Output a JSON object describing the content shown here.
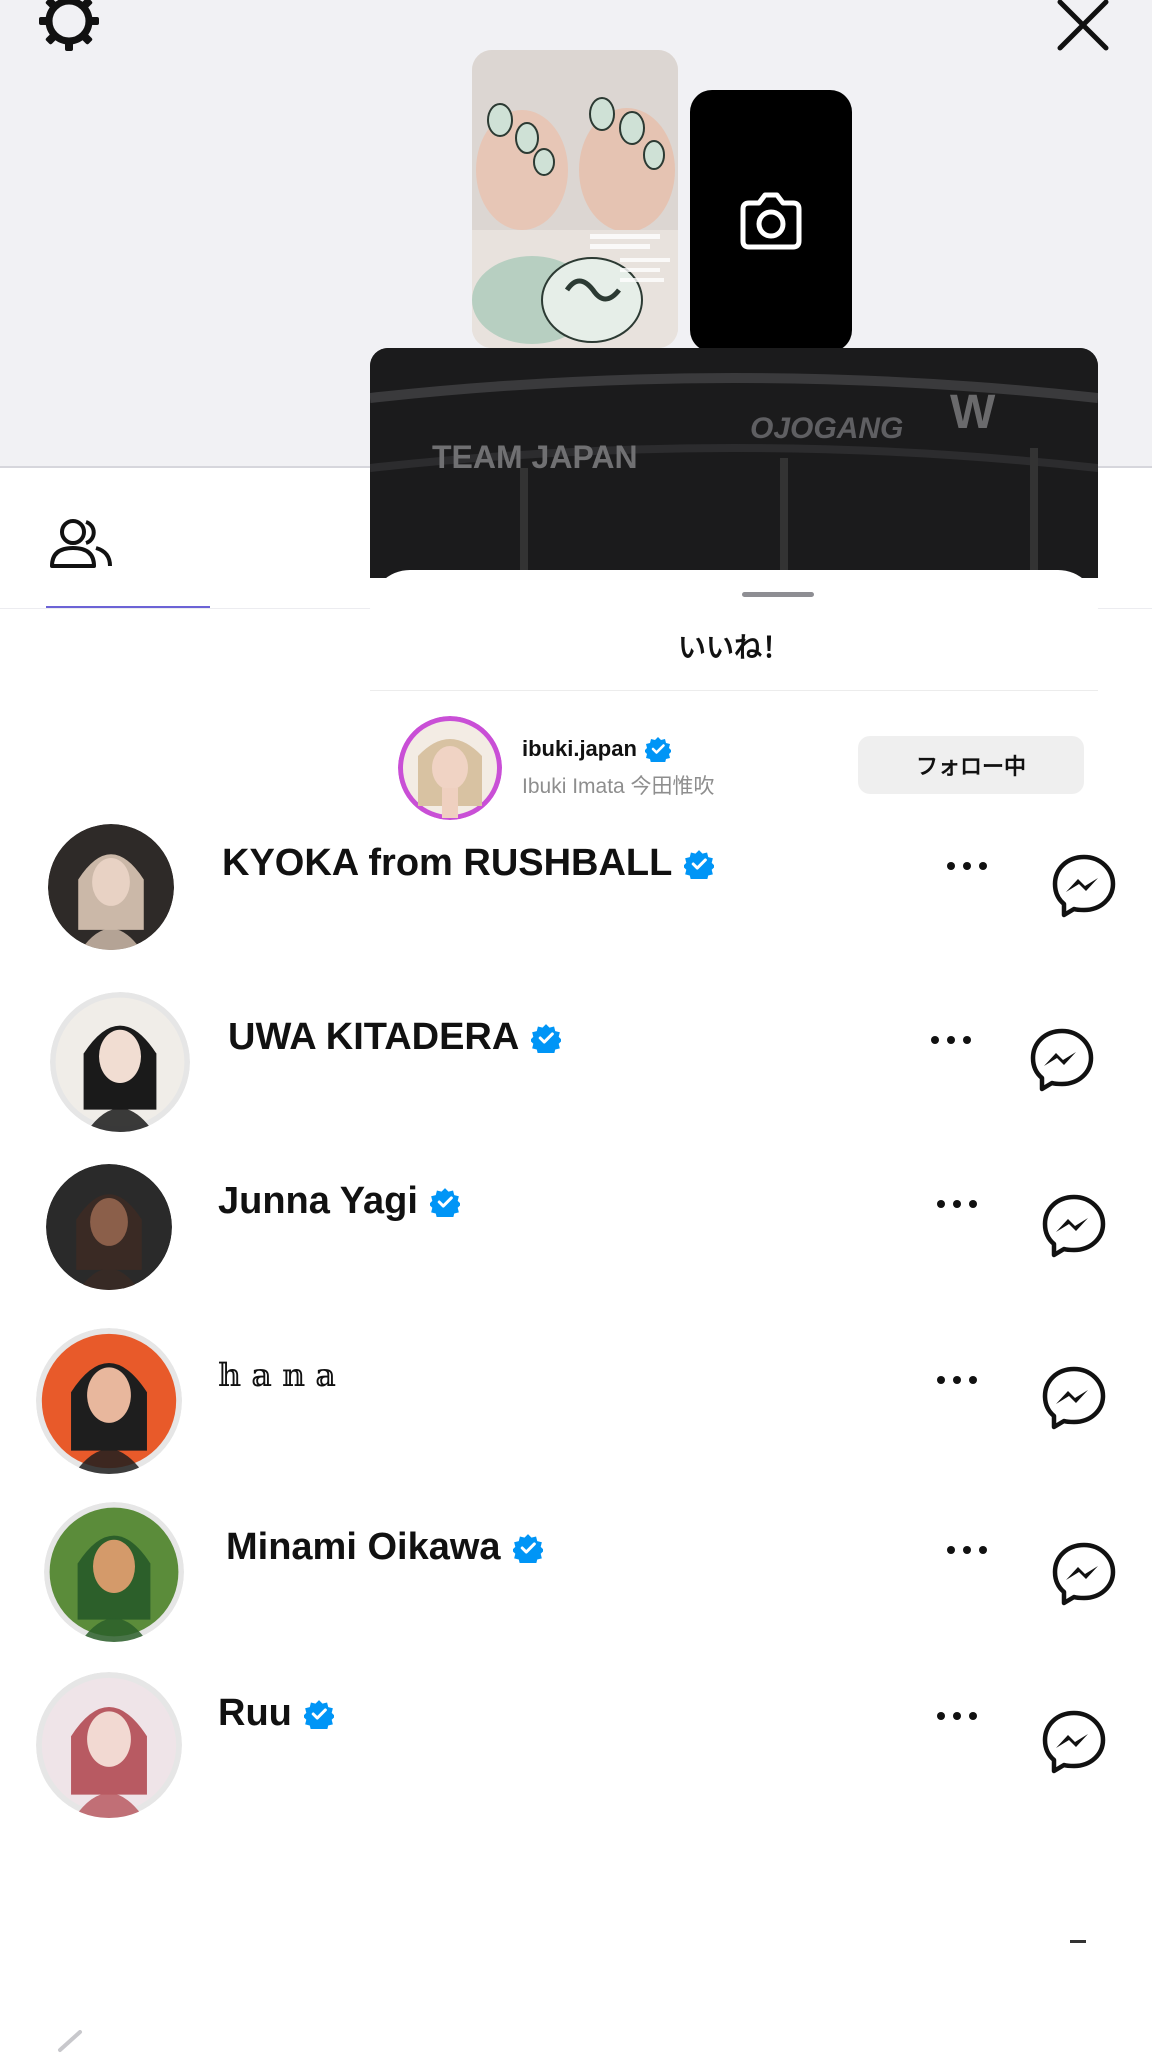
{
  "colors": {
    "verified": "#0095f6",
    "tab_active_underline": "#6c63d6",
    "follow_button_bg": "#efefef",
    "top_background": "#f1f1f4"
  },
  "icons": {
    "settings": "gear-icon",
    "close": "close-icon",
    "camera": "camera-icon",
    "tab": "people-icon",
    "more": "more-horizontal-icon",
    "message": "messenger-icon",
    "verified": "verified-badge-icon"
  },
  "story": {
    "banner_text": [
      "TEAM JAPAN",
      "OJOGANG",
      "W"
    ]
  },
  "likes_sheet": {
    "title": "いいね！",
    "liker": {
      "username": "ibuki.japan",
      "display_name": "Ibuki Imata 今田惟吹",
      "verified": true,
      "follow_label": "フォロー中"
    }
  },
  "users": [
    {
      "name": "KYOKA from RUSHBALL",
      "verified": true
    },
    {
      "name": "UWA KITADERA",
      "verified": true
    },
    {
      "name": "Junna Yagi",
      "verified": true
    },
    {
      "name": "𝕙𝕒𝕟𝕒",
      "verified": false
    },
    {
      "name": "Minami Oikawa",
      "verified": true
    },
    {
      "name": "Ruu",
      "verified": true
    }
  ]
}
